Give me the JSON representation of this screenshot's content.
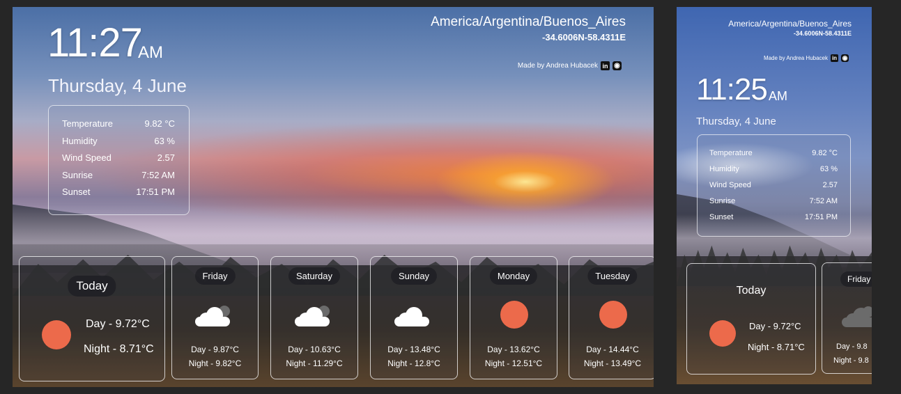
{
  "main": {
    "time": "11:27",
    "ampm": "AM",
    "date": "Thursday, 4 June",
    "location": "America/Argentina/Buenos_Aires",
    "coords": "-34.6006N-58.4311E",
    "credit": "Made by Andrea Hubacek",
    "linkedin_glyph": "in",
    "github_glyph": "◉",
    "stats": [
      {
        "label": "Temperature",
        "value": "9.82 °C"
      },
      {
        "label": "Humidity",
        "value": "63 %"
      },
      {
        "label": "Wind Speed",
        "value": "2.57"
      },
      {
        "label": "Sunrise",
        "value": "7:52 AM"
      },
      {
        "label": "Sunset",
        "value": "17:51 PM"
      }
    ],
    "forecast": [
      {
        "day": "Today",
        "icon": "sun-icon",
        "day_temp": "Day - 9.72°C",
        "night_temp": "Night - 8.71°C"
      },
      {
        "day": "Friday",
        "icon": "cloud-icon",
        "day_temp": "Day - 9.87°C",
        "night_temp": "Night - 9.82°C"
      },
      {
        "day": "Saturday",
        "icon": "cloud-icon",
        "day_temp": "Day - 10.63°C",
        "night_temp": "Night - 11.29°C"
      },
      {
        "day": "Sunday",
        "icon": "cloud-icon",
        "day_temp": "Day - 13.48°C",
        "night_temp": "Night - 12.8°C"
      },
      {
        "day": "Monday",
        "icon": "sun-icon",
        "day_temp": "Day - 13.62°C",
        "night_temp": "Night - 12.51°C"
      },
      {
        "day": "Tuesday",
        "icon": "sun-icon",
        "day_temp": "Day - 14.44°C",
        "night_temp": "Night - 13.49°C"
      }
    ]
  },
  "mobile": {
    "time": "11:25",
    "ampm": "AM",
    "date": "Thursday, 4 June",
    "location": "America/Argentina/Buenos_Aires",
    "coords": "-34.6006N-58.4311E",
    "credit": "Made by Andrea Hubacek",
    "stats": [
      {
        "label": "Temperature",
        "value": "9.82 °C"
      },
      {
        "label": "Humidity",
        "value": "63 %"
      },
      {
        "label": "Wind Speed",
        "value": "2.57"
      },
      {
        "label": "Sunrise",
        "value": "7:52 AM"
      },
      {
        "label": "Sunset",
        "value": "17:51 PM"
      }
    ],
    "forecast": [
      {
        "day": "Today",
        "icon": "sun-icon",
        "day_temp": "Day - 9.72°C",
        "night_temp": "Night - 8.71°C"
      },
      {
        "day": "Friday",
        "icon": "cloud-icon",
        "day_temp": "Day - 9.8",
        "night_temp": "Night - 9.8"
      }
    ]
  },
  "colors": {
    "sun": "#ec6a4b",
    "page_bg": "#262626",
    "pill_bg": "#1e1e23"
  }
}
